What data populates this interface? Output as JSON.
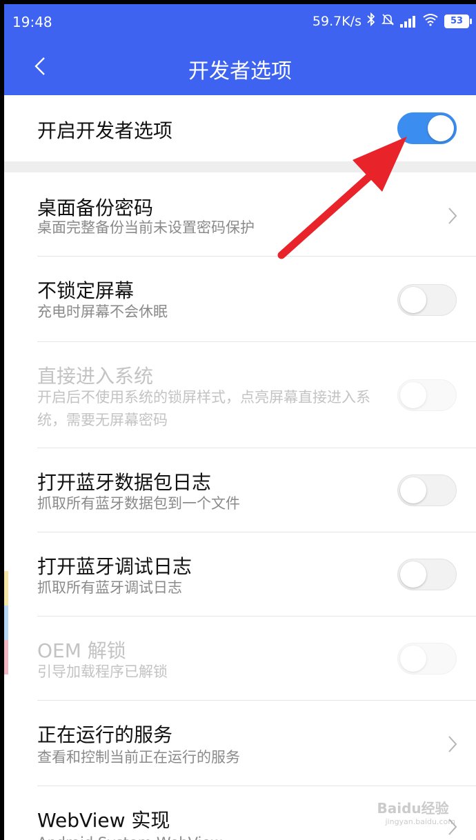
{
  "status_bar": {
    "time": "19:48",
    "net_speed": "59.7K/s",
    "icons": [
      "bluetooth-icon",
      "mute-icon",
      "signal-icon",
      "wifi-icon",
      "battery-icon"
    ],
    "battery": "53"
  },
  "header": {
    "title": "开发者选项",
    "back_icon": "chevron-left-icon",
    "color": "#3d63f0"
  },
  "master": {
    "label": "开启开发者选项",
    "enabled": true,
    "accent": "#3b8eef"
  },
  "items": [
    {
      "title": "桌面备份密码",
      "subtitle": "桌面完整备份当前未设置密码保护",
      "control": "chevron",
      "disabled": false
    },
    {
      "title": "不锁定屏幕",
      "subtitle": "充电时屏幕不会休眠",
      "control": "switch",
      "on": false,
      "disabled": false
    },
    {
      "title": "直接进入系统",
      "subtitle": "开启后不使用系统的锁屏样式，点亮屏幕直接进入系统，需要无屏幕密码",
      "control": "switch",
      "on": false,
      "disabled": true
    },
    {
      "title": "打开蓝牙数据包日志",
      "subtitle": "抓取所有蓝牙数据包到一个文件",
      "control": "switch",
      "on": false,
      "disabled": false
    },
    {
      "title": "打开蓝牙调试日志",
      "subtitle": "抓取所有蓝牙调试日志",
      "control": "switch",
      "on": false,
      "disabled": false
    },
    {
      "title": "OEM 解锁",
      "subtitle": "引导加载程序已解锁",
      "control": "switch",
      "on": false,
      "disabled": true
    },
    {
      "title": "正在运行的服务",
      "subtitle": "查看和控制当前正在运行的服务",
      "control": "chevron",
      "disabled": false
    },
    {
      "title": "WebView 实现",
      "subtitle": "Android System WebView",
      "control": "chevron",
      "disabled": false
    }
  ],
  "annotation": {
    "type": "red-arrow",
    "color": "#e8232a",
    "points_to": "master-toggle"
  },
  "watermark": {
    "logo": "Baidu经验",
    "url": "jingyan.baidu.com"
  }
}
